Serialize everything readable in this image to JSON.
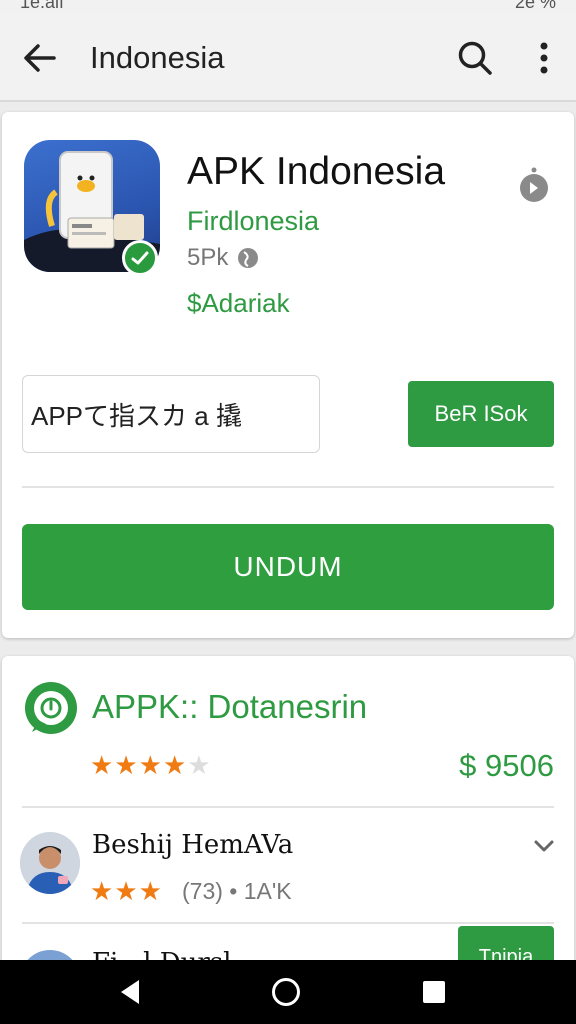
{
  "status_bar": {
    "left_text": "1e.aif",
    "right_text": "2e %"
  },
  "app_bar": {
    "title": "Indonesia",
    "back_icon": "arrow-left-icon",
    "search_icon": "search-icon",
    "more_icon": "more-vert-icon"
  },
  "app": {
    "name": "APK Indonesia",
    "developer": "Firdlonesia",
    "size": "5Pk",
    "price_label": "$Adariak",
    "search_field_value": "APPて指スカ a 撬",
    "secondary_button": "BeR ISok",
    "install_button": "UNDUM"
  },
  "list": {
    "title": "APPK:: Dotanesrin",
    "rating_stars": 4,
    "price": "$ 9506",
    "reviewer": {
      "name": "Beshij  HemAVa",
      "rating_stars": 3,
      "meta": "(73) • 1A'K"
    },
    "partial_name": "Fi...l Dursl...",
    "partial_button": "Tnipia"
  },
  "colors": {
    "accent_green": "#2e9a42",
    "star_orange": "#f07b12",
    "app_icon_blue": "#3c70cf"
  }
}
